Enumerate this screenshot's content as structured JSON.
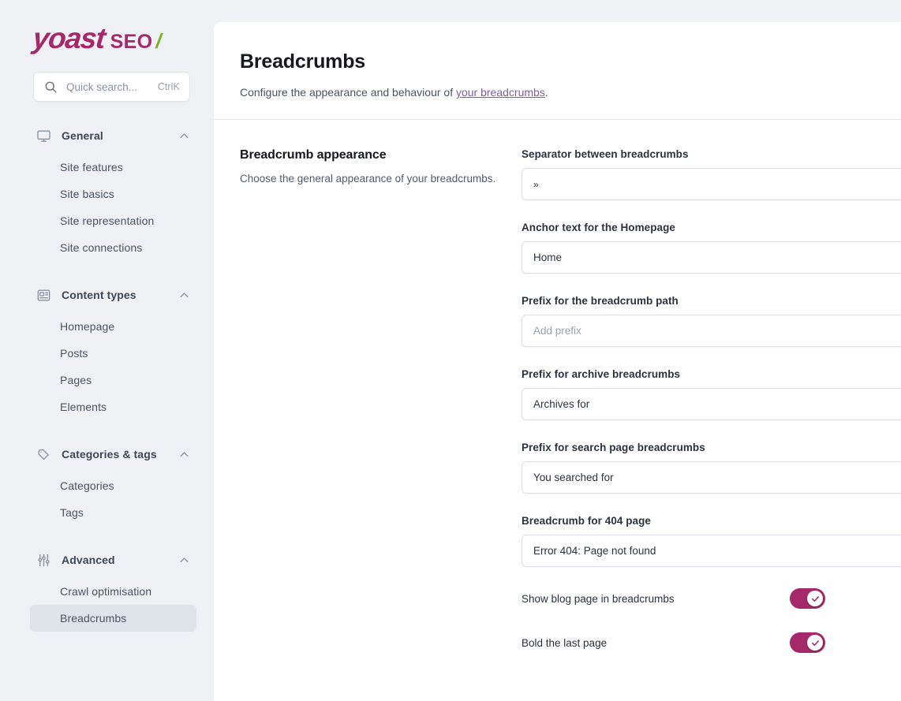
{
  "brand": {
    "logo_yoast": "yoast",
    "logo_seo": "SEO",
    "logo_slash": "/",
    "color_primary": "#a4286a",
    "color_accent_green": "#77b227",
    "color_link": "#7b5ea7"
  },
  "search": {
    "placeholder": "Quick search...",
    "shortcut": "CtrlK",
    "icon": "search-icon"
  },
  "sidebar": {
    "groups": [
      {
        "label": "General",
        "icon": "monitor-icon",
        "expanded": true,
        "children": [
          {
            "label": "Site features",
            "selected": false
          },
          {
            "label": "Site basics",
            "selected": false
          },
          {
            "label": "Site representation",
            "selected": false
          },
          {
            "label": "Site connections",
            "selected": false
          }
        ]
      },
      {
        "label": "Content types",
        "icon": "newspaper-icon",
        "expanded": true,
        "children": [
          {
            "label": "Homepage",
            "selected": false
          },
          {
            "label": "Posts",
            "selected": false
          },
          {
            "label": "Pages",
            "selected": false
          },
          {
            "label": "Elements",
            "selected": false
          }
        ]
      },
      {
        "label": "Categories & tags",
        "icon": "tag-icon",
        "expanded": true,
        "children": [
          {
            "label": "Categories",
            "selected": false
          },
          {
            "label": "Tags",
            "selected": false
          }
        ]
      },
      {
        "label": "Advanced",
        "icon": "sliders-icon",
        "expanded": true,
        "children": [
          {
            "label": "Crawl optimisation",
            "selected": false
          },
          {
            "label": "Breadcrumbs",
            "selected": true
          }
        ]
      }
    ]
  },
  "header": {
    "title": "Breadcrumbs",
    "description_before": "Configure the appearance and behaviour of ",
    "description_link": "your breadcrumbs",
    "description_after": "."
  },
  "section": {
    "title": "Breadcrumb appearance",
    "description": "Choose the general appearance of your breadcrumbs."
  },
  "fields": [
    {
      "label": "Separator between breadcrumbs",
      "value": "»",
      "is_placeholder": false,
      "name": "separator-input"
    },
    {
      "label": "Anchor text for the Homepage",
      "value": "Home",
      "is_placeholder": false,
      "name": "homepage-anchor-input"
    },
    {
      "label": "Prefix for the breadcrumb path",
      "value": "Add prefix",
      "is_placeholder": true,
      "name": "path-prefix-input"
    },
    {
      "label": "Prefix for archive breadcrumbs",
      "value": "Archives for",
      "is_placeholder": false,
      "name": "archive-prefix-input"
    },
    {
      "label": "Prefix for search page breadcrumbs",
      "value": "You searched for",
      "is_placeholder": false,
      "name": "search-prefix-input"
    },
    {
      "label": "Breadcrumb for 404 page",
      "value": "Error 404: Page not found",
      "is_placeholder": false,
      "name": "notfound-input"
    }
  ],
  "toggles": [
    {
      "label": "Show blog page in breadcrumbs",
      "enabled": true,
      "name": "show-blog-page-toggle"
    },
    {
      "label": "Bold the last page",
      "enabled": true,
      "name": "bold-last-page-toggle"
    }
  ]
}
